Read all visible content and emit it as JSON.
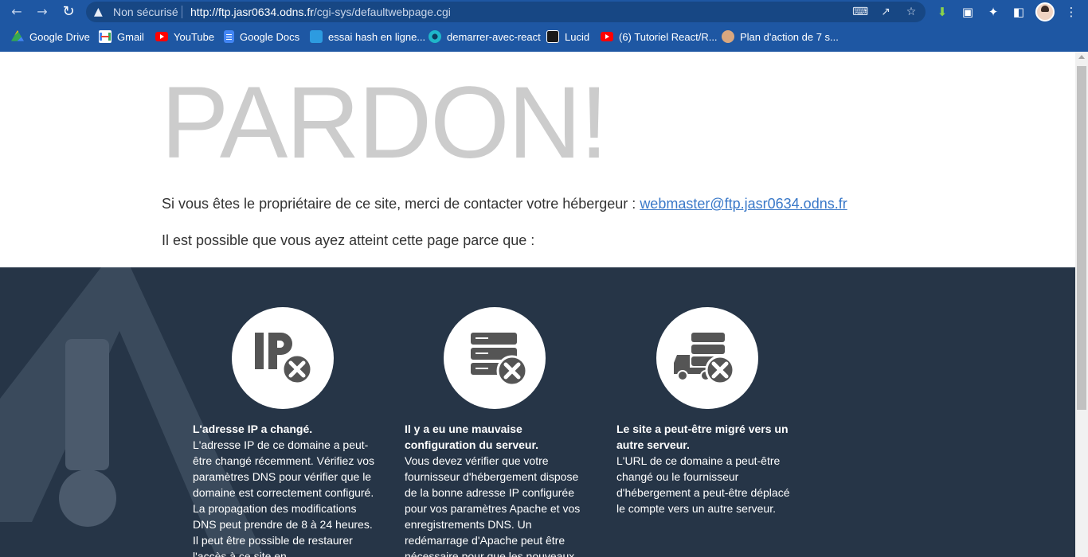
{
  "browser": {
    "security_label": "Non sécurisé",
    "url_host": "http://ftp.jasr0634.odns.fr",
    "url_path": "/cgi-sys/defaultwebpage.cgi",
    "bookmarks": [
      {
        "label": "Google Drive",
        "icon": "google-drive-icon",
        "color": "#34a853"
      },
      {
        "label": "Gmail",
        "icon": "gmail-icon",
        "color": "#ea4335"
      },
      {
        "label": "YouTube",
        "icon": "youtube-icon",
        "color": "#ff0000"
      },
      {
        "label": "Google Docs",
        "icon": "google-docs-icon",
        "color": "#4285f4"
      },
      {
        "label": "essai hash en ligne...",
        "icon": "hash-site-icon",
        "color": "#2d9be0"
      },
      {
        "label": "demarrer-avec-react",
        "icon": "react-site-icon",
        "color": "#1fb6c9"
      },
      {
        "label": "Lucid",
        "icon": "lucid-icon",
        "color": "#1a1a1a"
      },
      {
        "label": "(6) Tutoriel React/R...",
        "icon": "youtube-icon",
        "color": "#ff0000"
      },
      {
        "label": "Plan d'action de 7 s...",
        "icon": "person-avatar-icon",
        "color": "#d9a77f"
      }
    ]
  },
  "page": {
    "title": "PARDON!",
    "intro_text": "Si vous êtes le propriétaire de ce site, merci de contacter votre hébergeur : ",
    "contact_email": "webmaster@ftp.jasr0634.odns.fr",
    "possible_reason": "Il est possible que vous ayez atteint cette page parce que :",
    "reasons": [
      {
        "icon": "ip-error-icon",
        "title": "L'adresse IP a changé.",
        "body": "L'adresse IP de ce domaine a peut-être changé récemment. Vérifiez vos paramètres DNS pour vérifier que le domaine est correctement configuré. La propagation des modifications DNS peut prendre de 8 à 24 heures. Il peut être possible de restaurer l'accès à ce site en"
      },
      {
        "icon": "server-error-icon",
        "title": "Il y a eu une mauvaise configuration du serveur.",
        "body": "Vous devez vérifier que votre fournisseur d'hébergement dispose de la bonne adresse IP configurée pour vos paramètres Apache et vos enregistrements DNS. Un redémarrage d'Apache peut être nécessaire pour que les nouveaux"
      },
      {
        "icon": "server-moved-icon",
        "title": "Le site a peut-être migré vers un autre serveur.",
        "body": "L'URL de ce domaine a peut-être changé ou le fournisseur d'hébergement a peut-être déplacé le compte vers un autre serveur."
      }
    ]
  },
  "colors": {
    "chrome": "#1e57a3",
    "title": "#cccccc",
    "link": "#3978c8",
    "dark_section": "#263547"
  }
}
